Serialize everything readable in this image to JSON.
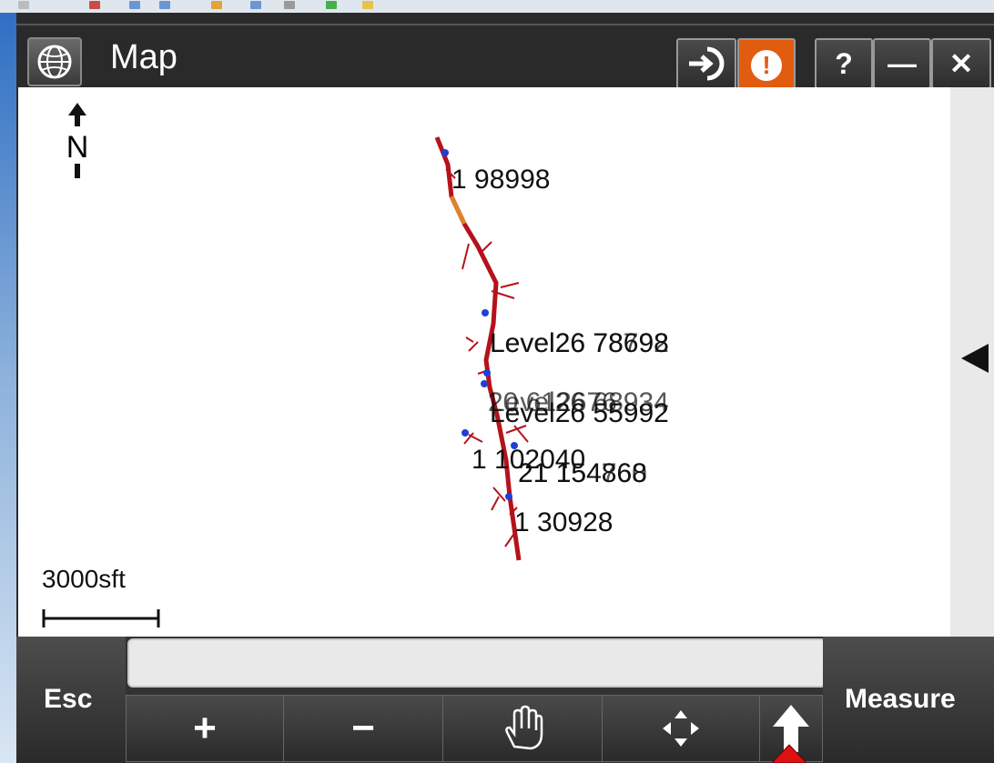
{
  "window": {
    "title": "Map"
  },
  "titlebar": {
    "help_label": "?",
    "minimize_label": "—",
    "close_label": "✕",
    "alert_label": "!"
  },
  "map": {
    "north_label": "N",
    "scale_label": "3000sft",
    "labels": [
      "1 98998",
      "Level26 78698",
      "Level26 78792",
      "Level26 55992",
      "Level26 68934",
      "20 612676",
      "1 102040",
      "21 154868",
      "21 154760",
      "1 30928"
    ]
  },
  "bottom": {
    "esc_label": "Esc",
    "measure_label": "Measure",
    "zoom_in_label": "+",
    "zoom_out_label": "−"
  },
  "colors": {
    "route": "#b5121b",
    "route_segment": "#e0822a",
    "point": "#1f3fd6",
    "alert": "#e25c10"
  }
}
